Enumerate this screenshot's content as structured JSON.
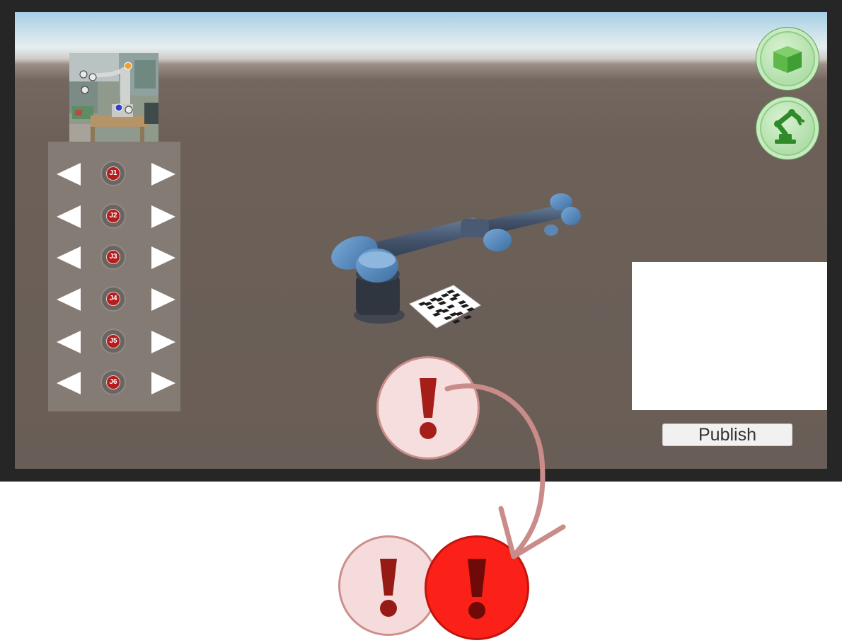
{
  "joints": [
    {
      "label": "J1"
    },
    {
      "label": "J2"
    },
    {
      "label": "J3"
    },
    {
      "label": "J4"
    },
    {
      "label": "J5"
    },
    {
      "label": "J6"
    }
  ],
  "publish_label": "Publish",
  "icons": {
    "top_right_1": "cube-icon",
    "top_right_2": "robot-arm-icon",
    "alert": "exclamation-icon"
  },
  "colors": {
    "accent_green": "#b5e0ad",
    "alert_pale": "#f6dede",
    "alert_active": "#fb2118",
    "joint_badge": "#b31d1d",
    "ground": "#6c6058"
  }
}
